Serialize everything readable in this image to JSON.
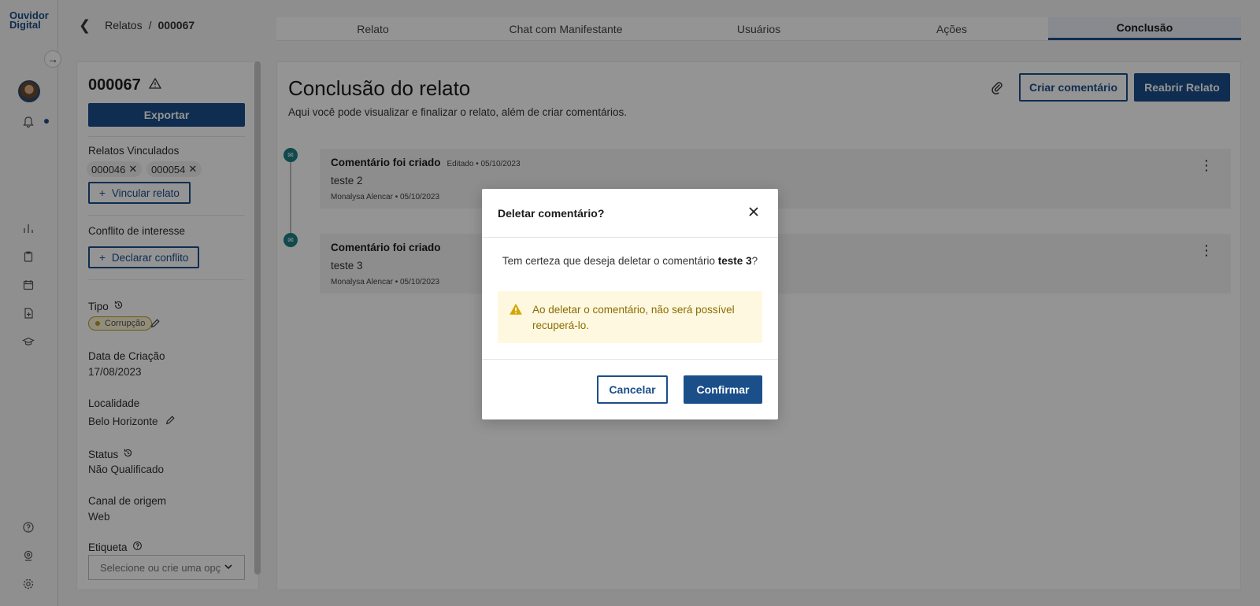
{
  "logo": {
    "line1": "Ouvidor",
    "line2": "Digital"
  },
  "breadcrumb": {
    "parent": "Relatos",
    "separator": "/",
    "current": "000067"
  },
  "tabs": [
    {
      "label": "Relato",
      "active": false
    },
    {
      "label": "Chat com Manifestante",
      "active": false
    },
    {
      "label": "Usuários",
      "active": false
    },
    {
      "label": "Ações",
      "active": false
    },
    {
      "label": "Conclusão",
      "active": true
    }
  ],
  "left_panel": {
    "report_id": "000067",
    "export_label": "Exportar",
    "linked_label": "Relatos Vinculados",
    "linked_chips": [
      "000046",
      "000054"
    ],
    "link_button": "Vincular relato",
    "conflict_label": "Conflito de interesse",
    "conflict_button": "Declarar conflito",
    "tipo_label": "Tipo",
    "tipo_tag": "Corrupção",
    "creation_label": "Data de Criação",
    "creation_value": "17/08/2023",
    "locality_label": "Localidade",
    "locality_value": "Belo Horizonte",
    "status_label": "Status",
    "status_value": "Não Qualificado",
    "channel_label": "Canal de origem",
    "channel_value": "Web",
    "tag_label": "Etiqueta",
    "tag_placeholder": "Selecione ou crie uma opç"
  },
  "main": {
    "title": "Conclusão do relato",
    "subtitle": "Aqui você pode visualizar e finalizar o relato, além de criar comentários.",
    "create_comment_button": "Criar comentário",
    "reopen_button": "Reabrir Relato",
    "comments": [
      {
        "title": "Comentário foi criado",
        "meta": "Editado • 05/10/2023",
        "body": "teste 2",
        "author": "Monalysa Alencar • 05/10/2023"
      },
      {
        "title": "Comentário foi criado",
        "meta": "",
        "body": "teste 3",
        "author": "Monalysa Alencar • 05/10/2023"
      }
    ]
  },
  "modal": {
    "title": "Deletar comentário?",
    "message_prefix": "Tem certeza que deseja deletar o comentário ",
    "message_target": "teste 3",
    "message_suffix": "?",
    "warning": "Ao deletar o comentário, não será possível recuperá-lo.",
    "cancel": "Cancelar",
    "confirm": "Confirmar"
  },
  "colors": {
    "primary": "#1b4f8a",
    "timeline_icon": "#1e7f86",
    "warning_bg": "#fff8e1",
    "warning_text": "#8a6d00"
  }
}
